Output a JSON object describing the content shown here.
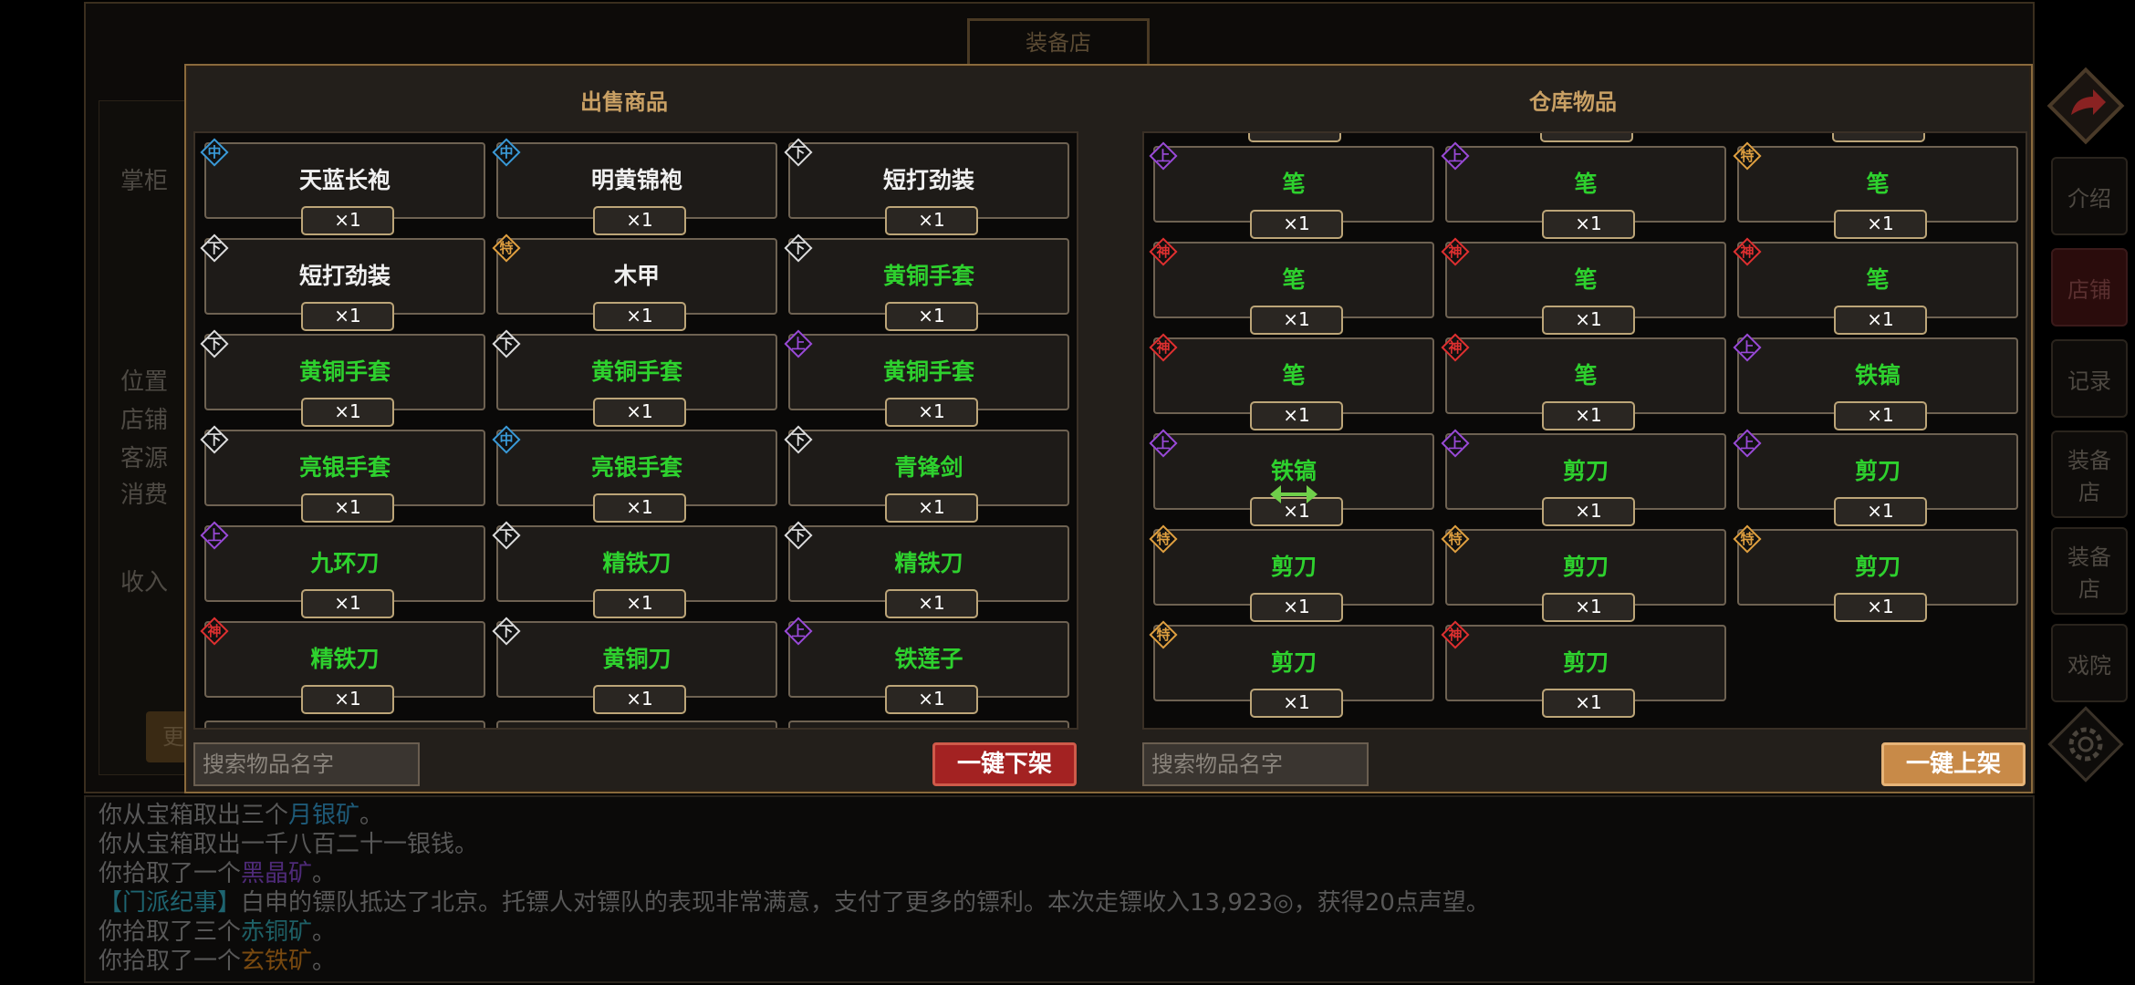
{
  "background": {
    "shop_title": "装备店",
    "labels": [
      "掌柜",
      "位置",
      "店铺",
      "客源",
      "消费",
      "收入"
    ],
    "left_button": "更"
  },
  "nav": {
    "items": [
      {
        "label": "介绍"
      },
      {
        "label": "店铺",
        "active": true
      },
      {
        "label": "记录"
      },
      {
        "label": "装备店"
      },
      {
        "label": "装备店"
      },
      {
        "label": "戏院"
      }
    ]
  },
  "modal": {
    "sell_title": "出售商品",
    "store_title": "仓库物品",
    "sell_search_placeholder": "搜索物品名字",
    "store_search_placeholder": "搜索物品名字",
    "unlist_all_label": "一键下架",
    "list_all_label": "一键上架"
  },
  "sell_items": [
    {
      "name": "天蓝长袍",
      "qty": "×1",
      "badge": "中",
      "badge_color": "#3a9ad8",
      "name_color": "white"
    },
    {
      "name": "明黄锦袍",
      "qty": "×1",
      "badge": "中",
      "badge_color": "#3a9ad8",
      "name_color": "white"
    },
    {
      "name": "短打劲装",
      "qty": "×1",
      "badge": "下",
      "badge_color": "#dddddd",
      "name_color": "white"
    },
    {
      "name": "短打劲装",
      "qty": "×1",
      "badge": "下",
      "badge_color": "#dddddd",
      "name_color": "white"
    },
    {
      "name": "木甲",
      "qty": "×1",
      "badge": "特",
      "badge_color": "#e0a040",
      "name_color": "white"
    },
    {
      "name": "黄铜手套",
      "qty": "×1",
      "badge": "下",
      "badge_color": "#dddddd",
      "name_color": "green"
    },
    {
      "name": "黄铜手套",
      "qty": "×1",
      "badge": "下",
      "badge_color": "#dddddd",
      "name_color": "green"
    },
    {
      "name": "黄铜手套",
      "qty": "×1",
      "badge": "下",
      "badge_color": "#dddddd",
      "name_color": "green"
    },
    {
      "name": "黄铜手套",
      "qty": "×1",
      "badge": "上",
      "badge_color": "#9a4ad8",
      "name_color": "green"
    },
    {
      "name": "亮银手套",
      "qty": "×1",
      "badge": "下",
      "badge_color": "#dddddd",
      "name_color": "green"
    },
    {
      "name": "亮银手套",
      "qty": "×1",
      "badge": "中",
      "badge_color": "#3a9ad8",
      "name_color": "green"
    },
    {
      "name": "青锋剑",
      "qty": "×1",
      "badge": "下",
      "badge_color": "#dddddd",
      "name_color": "green"
    },
    {
      "name": "九环刀",
      "qty": "×1",
      "badge": "上",
      "badge_color": "#9a4ad8",
      "name_color": "green"
    },
    {
      "name": "精铁刀",
      "qty": "×1",
      "badge": "下",
      "badge_color": "#dddddd",
      "name_color": "green"
    },
    {
      "name": "精铁刀",
      "qty": "×1",
      "badge": "下",
      "badge_color": "#dddddd",
      "name_color": "green"
    },
    {
      "name": "精铁刀",
      "qty": "×1",
      "badge": "神",
      "badge_color": "#e03030",
      "name_color": "green"
    },
    {
      "name": "黄铜刀",
      "qty": "×1",
      "badge": "下",
      "badge_color": "#dddddd",
      "name_color": "green"
    },
    {
      "name": "铁莲子",
      "qty": "×1",
      "badge": "上",
      "badge_color": "#9a4ad8",
      "name_color": "green"
    }
  ],
  "store_items": [
    {
      "name": "笔",
      "qty": "×1",
      "badge": "上",
      "badge_color": "#9a4ad8",
      "name_color": "green"
    },
    {
      "name": "笔",
      "qty": "×1",
      "badge": "上",
      "badge_color": "#9a4ad8",
      "name_color": "green"
    },
    {
      "name": "笔",
      "qty": "×1",
      "badge": "特",
      "badge_color": "#e0a040",
      "name_color": "green"
    },
    {
      "name": "笔",
      "qty": "×1",
      "badge": "神",
      "badge_color": "#e03030",
      "name_color": "green"
    },
    {
      "name": "笔",
      "qty": "×1",
      "badge": "神",
      "badge_color": "#e03030",
      "name_color": "green"
    },
    {
      "name": "笔",
      "qty": "×1",
      "badge": "神",
      "badge_color": "#e03030",
      "name_color": "green"
    },
    {
      "name": "笔",
      "qty": "×1",
      "badge": "神",
      "badge_color": "#e03030",
      "name_color": "green"
    },
    {
      "name": "笔",
      "qty": "×1",
      "badge": "神",
      "badge_color": "#e03030",
      "name_color": "green"
    },
    {
      "name": "铁镐",
      "qty": "×1",
      "badge": "上",
      "badge_color": "#9a4ad8",
      "name_color": "green"
    },
    {
      "name": "铁镐",
      "qty": "×1",
      "badge": "上",
      "badge_color": "#9a4ad8",
      "name_color": "green"
    },
    {
      "name": "剪刀",
      "qty": "×1",
      "badge": "上",
      "badge_color": "#9a4ad8",
      "name_color": "green"
    },
    {
      "name": "剪刀",
      "qty": "×1",
      "badge": "上",
      "badge_color": "#9a4ad8",
      "name_color": "green"
    },
    {
      "name": "剪刀",
      "qty": "×1",
      "badge": "特",
      "badge_color": "#e0a040",
      "name_color": "green"
    },
    {
      "name": "剪刀",
      "qty": "×1",
      "badge": "特",
      "badge_color": "#e0a040",
      "name_color": "green"
    },
    {
      "name": "剪刀",
      "qty": "×1",
      "badge": "特",
      "badge_color": "#e0a040",
      "name_color": "green"
    },
    {
      "name": "剪刀",
      "qty": "×1",
      "badge": "特",
      "badge_color": "#e0a040",
      "name_color": "green"
    },
    {
      "name": "剪刀",
      "qty": "×1",
      "badge": "神",
      "badge_color": "#e03030",
      "name_color": "green"
    }
  ],
  "log": [
    {
      "parts": [
        {
          "t": "你从宝箱取出三个"
        },
        {
          "t": "月银矿",
          "c": "c-blue"
        },
        {
          "t": "。"
        }
      ]
    },
    {
      "parts": [
        {
          "t": "你从宝箱取出一千八百二十一银钱。"
        }
      ]
    },
    {
      "parts": [
        {
          "t": "你拾取了一个"
        },
        {
          "t": "黑晶矿",
          "c": "c-purple"
        },
        {
          "t": "。"
        }
      ]
    },
    {
      "parts": [
        {
          "t": "【门派纪事】",
          "c": "c-cyan"
        },
        {
          "t": "白申的镖队抵达了北京。托镖人对镖队的表现非常满意，支付了更多的镖利。本次走镖收入13,923"
        },
        {
          "t": "◎"
        },
        {
          "t": "，获得20点声望。"
        }
      ]
    },
    {
      "parts": [
        {
          "t": "你拾取了三个"
        },
        {
          "t": "赤铜矿",
          "c": "c-teal"
        },
        {
          "t": "。"
        }
      ]
    },
    {
      "parts": [
        {
          "t": "你拾取了一个"
        },
        {
          "t": "玄铁矿",
          "c": "c-orange"
        },
        {
          "t": "。"
        }
      ]
    }
  ]
}
